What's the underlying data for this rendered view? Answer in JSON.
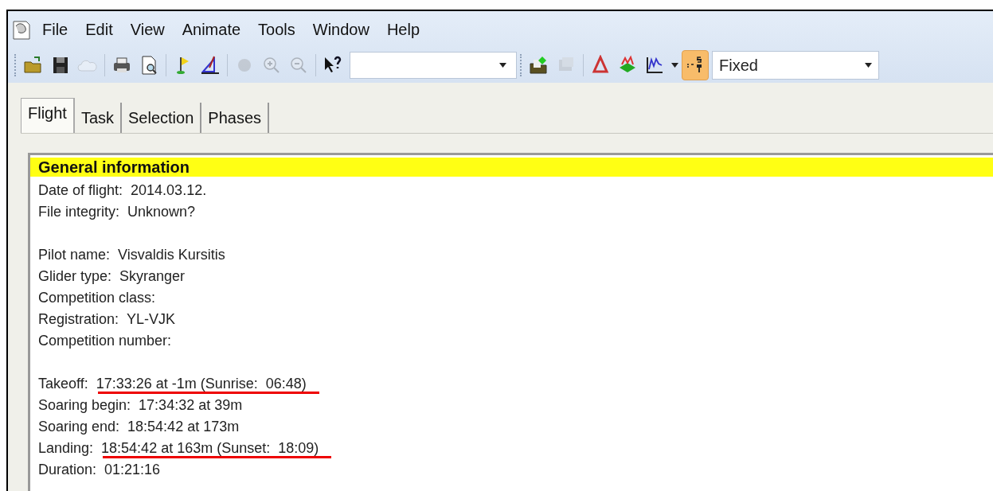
{
  "menu": [
    "File",
    "Edit",
    "View",
    "Animate",
    "Tools",
    "Window",
    "Help"
  ],
  "toolbar_left": [
    {
      "disabled": false
    },
    {
      "disabled": false
    },
    {
      "disabled": true
    },
    {
      "disabled": false
    },
    {
      "disabled": false
    },
    {
      "disabled": false
    },
    {
      "disabled": false
    },
    {
      "disabled": true
    },
    {
      "disabled": true
    },
    {
      "disabled": true
    },
    {
      "disabled": false
    }
  ],
  "toolbar_right": [
    {
      "disabled": false,
      "pressed": false
    },
    {
      "disabled": true,
      "pressed": false
    },
    {
      "disabled": false,
      "pressed": false
    },
    {
      "disabled": false,
      "pressed": false
    },
    {
      "disabled": false,
      "pressed": false
    },
    {
      "disabled": false,
      "pressed": true
    }
  ],
  "scale_select": {
    "value": "Fixed"
  },
  "tabs": [
    {
      "label": "Flight",
      "selected": true
    },
    {
      "label": "Task",
      "selected": false
    },
    {
      "label": "Selection",
      "selected": false
    },
    {
      "label": "Phases",
      "selected": false
    }
  ],
  "section": {
    "title": "General information"
  },
  "lines": [
    {
      "kind": "line",
      "label": "Date of flight:",
      "value": "2014.03.12.",
      "underlined": false
    },
    {
      "kind": "line",
      "label": "File integrity:",
      "value": "Unknown?",
      "underlined": false
    },
    {
      "kind": "blank"
    },
    {
      "kind": "line",
      "label": "Pilot name:",
      "value": "Visvaldis Kursitis",
      "underlined": false
    },
    {
      "kind": "line",
      "label": "Glider type:",
      "value": "Skyranger",
      "underlined": false
    },
    {
      "kind": "line",
      "label": "Competition class:",
      "underlined": false
    },
    {
      "kind": "line",
      "label": "Registration:",
      "value": "YL-VJK",
      "underlined": false
    },
    {
      "kind": "line",
      "label": "Competition number:",
      "underlined": false
    },
    {
      "kind": "blank"
    },
    {
      "kind": "line",
      "label": "Takeoff:",
      "value": "17:33:26 at -1m (Sunrise:  06:48)",
      "underlined": true
    },
    {
      "kind": "line",
      "label": "Soaring begin:",
      "value": "17:34:32 at 39m",
      "underlined": false
    },
    {
      "kind": "line",
      "label": "Soaring end:",
      "value": "18:54:42 at 173m",
      "underlined": false
    },
    {
      "kind": "line",
      "label": "Landing:",
      "value": "18:54:42 at 163m (Sunset:  18:09)",
      "underlined": true
    },
    {
      "kind": "line",
      "label": "Duration:",
      "value": "01:21:16",
      "underlined": false
    }
  ]
}
